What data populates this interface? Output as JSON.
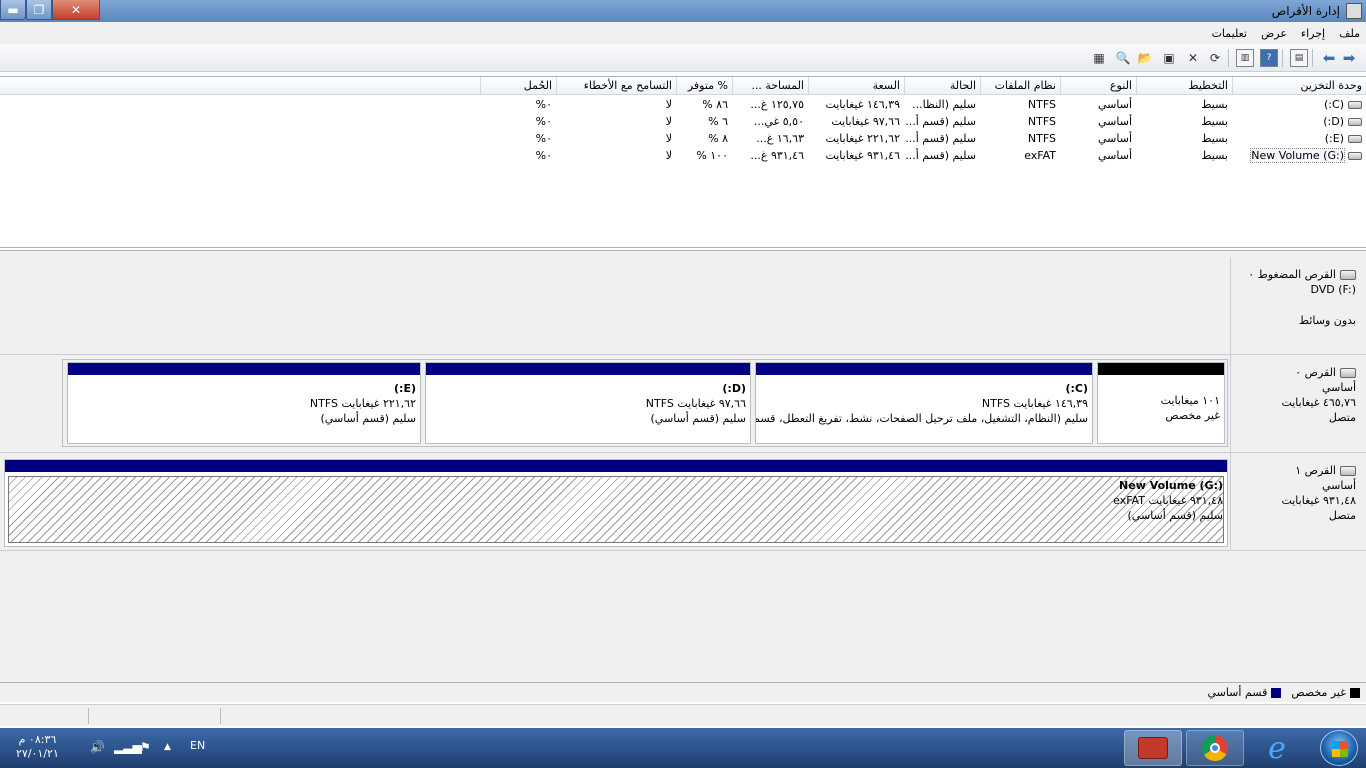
{
  "window": {
    "title": "إدارة الأقراص"
  },
  "menu": [
    "ملف",
    "إجراء",
    "عرض",
    "تعليمات"
  ],
  "columns": [
    "وحدة التخزين",
    "التخطيط",
    "النوع",
    "نظام الملفات",
    "الحالة",
    "السعة",
    "المساحة ...",
    "% متوفر",
    "التسامح مع الأخطاء",
    "الحُمل"
  ],
  "volumes": [
    {
      "name": "(C:)",
      "layout": "بسيط",
      "type": "أساسي",
      "fs": "NTFS",
      "status": "سليم (النظا...",
      "capacity": "١٤٦,٣٩ غيغابايت",
      "free": "١٢٥,٧٥ غ...",
      "pct": "٨٦ %",
      "fault": "لا",
      "overhead": "٠%"
    },
    {
      "name": "(D:)",
      "layout": "بسيط",
      "type": "أساسي",
      "fs": "NTFS",
      "status": "سليم (قسم أ...",
      "capacity": "٩٧,٦٦ غيغابايت",
      "free": "٥,٥٠ غي...",
      "pct": "٦ %",
      "fault": "لا",
      "overhead": "٠%"
    },
    {
      "name": "(E:)",
      "layout": "بسيط",
      "type": "أساسي",
      "fs": "NTFS",
      "status": "سليم (قسم أ...",
      "capacity": "٢٢١,٦٢ غيغابايت",
      "free": "١٦,٦٣ غ...",
      "pct": "٨ %",
      "fault": "لا",
      "overhead": "٠%"
    },
    {
      "name": "New Volume (G:)",
      "layout": "بسيط",
      "type": "أساسي",
      "fs": "exFAT",
      "status": "سليم (قسم أ...",
      "capacity": "٩٣١,٤٦ غيغابايت",
      "free": "٩٣١,٤٦ غ...",
      "pct": "١٠٠ %",
      "fault": "لا",
      "overhead": "٠%"
    }
  ],
  "disks": {
    "cdrom": {
      "l1": "القرص المضغوط ٠",
      "l2": "DVD (F:)",
      "l3": "بدون وسائط"
    },
    "disk0": {
      "l1": "القرص ٠",
      "l2": "أساسي",
      "l3": "٤٦٥,٧٦ غيغابايت",
      "l4": "متصل",
      "parts": [
        {
          "a": "١٠١ ميغابايت",
          "b": "غير مخصص"
        },
        {
          "name": "(C:)",
          "size": "١٤٦,٣٩ غيغابايت NTFS",
          "status": "سليم (النظام، التشغيل، ملف ترحيل الصفحات، نشط، تفريغ التعطل، قسم أ"
        },
        {
          "name": "(D:)",
          "size": "٩٧,٦٦ غيغابايت NTFS",
          "status": "سليم (قسم أساسي)"
        },
        {
          "name": "(E:)",
          "size": "٢٢١,٦٢ غيغابايت NTFS",
          "status": "سليم (قسم أساسي)"
        }
      ]
    },
    "disk1": {
      "l1": "القرص ١",
      "l2": "أساسي",
      "l3": "٩٣١,٤٨ غيغابايت",
      "l4": "متصل",
      "part": {
        "name": "New Volume  (G:)",
        "size": "٩٣١,٤٨ غيغابايت exFAT",
        "status": "سليم (قسم أساسي)"
      }
    }
  },
  "legend": {
    "unallocated": "غير مخصص",
    "primary": "قسم أساسي"
  },
  "taskbar": {
    "time": "٠٨:٣٦ م",
    "date": "٢٧/٠١/٢١",
    "lang": "EN"
  },
  "colors": {
    "primary": "#000080",
    "unallocated": "#000000",
    "taskbar": "#1f3f70"
  }
}
